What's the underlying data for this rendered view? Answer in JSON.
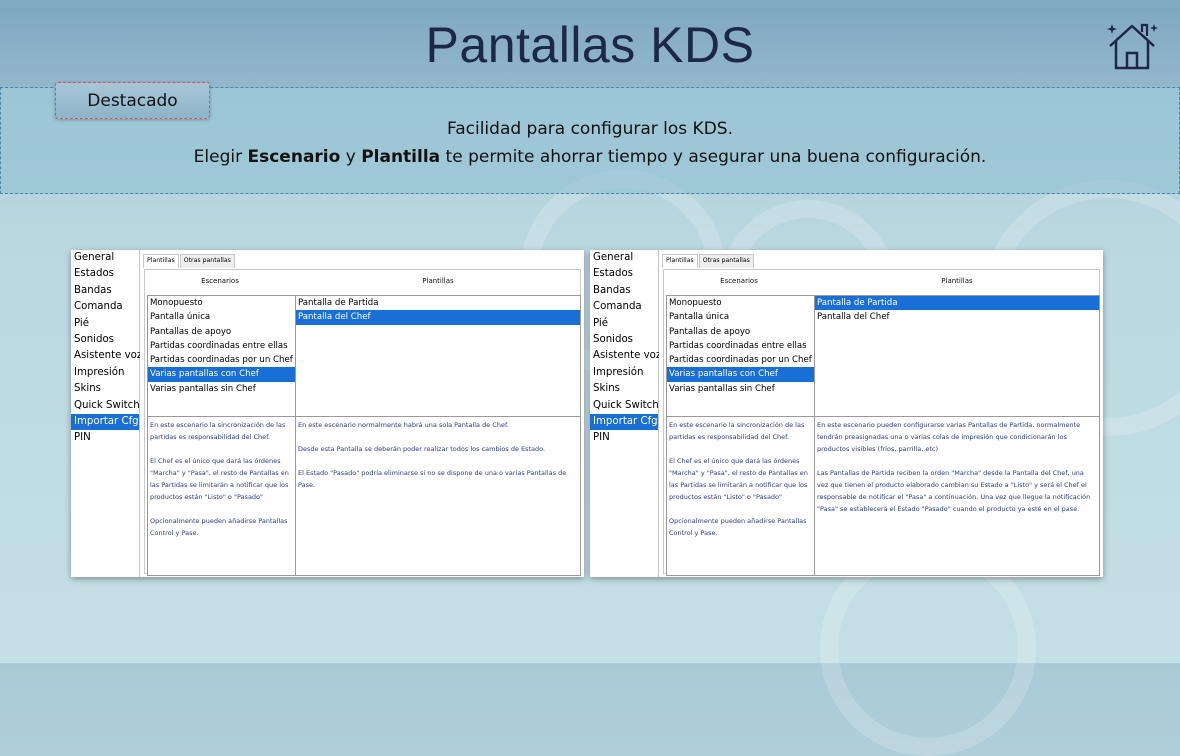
{
  "title": "Pantallas KDS",
  "badge": "Destacado",
  "banner": {
    "line1": "Facilidad para configurar los KDS.",
    "line2_a": "Elegir ",
    "line2_b": "Escenario",
    "line2_c": " y ",
    "line2_d": "Plantilla",
    "line2_e": " te permite ahorrar tiempo y asegurar una buena configuración."
  },
  "icons": {
    "home": "home-icon"
  },
  "colors": {
    "selection": "#1a6fd6",
    "title": "#1d2748",
    "description_text": "#2b3a8a"
  },
  "screens": [
    {
      "nav": [
        "General",
        "Estados",
        "Bandas",
        "Comanda",
        "Pié",
        "Sonidos",
        "Asistente voz",
        "Impresión",
        "Skins",
        "Quick Switch",
        "Importar Cfg",
        "PIN"
      ],
      "nav_selected": 10,
      "tabs": [
        "Plantillas",
        "Otras pantallas"
      ],
      "header_left": "Escenarios",
      "header_right": "Plantillas",
      "scenarios": [
        "Monopuesto",
        "Pantalla única",
        "Pantallas de apoyo",
        "Partidas coordinadas entre ellas",
        "Partidas coordinadas por un Chef",
        "Varias pantallas con Chef",
        "Varias pantallas sin Chef"
      ],
      "scenario_selected": 5,
      "templates": [
        "Pantalla de Partida",
        "Pantalla del Chef"
      ],
      "template_selected": 1,
      "desc_left": [
        "En este escenario la sincronización de las partidas es responsabilidad del Chef.",
        "El Chef es el único que dará las órdenes \"Marcha\" y \"Pasa\", el resto de Pantallas en las Partidas se limitarán a notificar que los productos están \"Listo\" o \"Pasado\"",
        "Opcionalmente pueden añadirse Pantallas Control y Pase."
      ],
      "desc_right": [
        "En este escenario normalmente habrá una sola Pantalla de Chef.",
        "Desde esta Pantalla se deberán poder realizar todos los cambios de Estado.",
        "El Estado \"Pasado\" podría eliminarse si no se dispone de una o varias Pantallas de Pase."
      ]
    },
    {
      "nav": [
        "General",
        "Estados",
        "Bandas",
        "Comanda",
        "Pié",
        "Sonidos",
        "Asistente voz",
        "Impresión",
        "Skins",
        "Quick Switch",
        "Importar Cfg",
        "PIN"
      ],
      "nav_selected": 10,
      "tabs": [
        "Plantillas",
        "Otras pantallas"
      ],
      "header_left": "Escenarios",
      "header_right": "Plantillas",
      "scenarios": [
        "Monopuesto",
        "Pantalla única",
        "Pantallas de apoyo",
        "Partidas coordinadas entre ellas",
        "Partidas coordinadas por un Chef",
        "Varias pantallas con Chef",
        "Varias pantallas sin Chef"
      ],
      "scenario_selected": 5,
      "templates": [
        "Pantalla de Partida",
        "Pantalla del Chef"
      ],
      "template_selected": 0,
      "desc_left": [
        "En este escenario la sincronización de las partidas es responsabilidad del Chef.",
        "El Chef es el único que dará las órdenes \"Marcha\" y \"Pasa\", el resto de Pantallas en las Partidas se limitarán a notificar que los productos están \"Listo\" o \"Pasado\"",
        "Opcionalmente pueden añadirse Pantallas Control y Pase."
      ],
      "desc_right": [
        "En este escenario pueden configurarse varias Pantallas de Partida, normalmente tendrán preasignadas una o varias colas de impresión que condicionarán los productos visibles (fríos, parrilla, etc)",
        "Las Pantallas de Partida reciben la orden \"Marcha\" desde la Pantalla del Chef, una vez que tienen el producto elaborado cambian su Estado a \"Listo\" y será el Chef el responsable de notificar el \"Pasa\" a continuación. Una vez que llegue la notificación \"Pasa\" se establecerá el Estado \"Pasado\" cuando el producto ya esté en el pase."
      ]
    }
  ]
}
